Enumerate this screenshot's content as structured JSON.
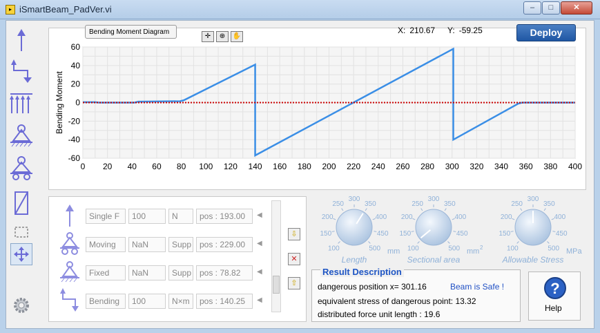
{
  "window": {
    "title": "iSmartBeam_PadVer.vi",
    "minimize": "–",
    "maximize": "□",
    "close": "✕"
  },
  "chart": {
    "palette_label": "Bending Moment Diagram",
    "x_label": "X:",
    "x_value": "210.67",
    "y_label": "Y:",
    "y_value": "-59.25",
    "deploy_label": "Deploy"
  },
  "chart_data": {
    "type": "line",
    "title": "",
    "xlabel": "",
    "ylabel": "Bending Moment",
    "xlim": [
      0,
      400
    ],
    "ylim": [
      -60,
      60
    ],
    "x_ticks": [
      0,
      20,
      40,
      60,
      80,
      100,
      120,
      140,
      160,
      180,
      200,
      220,
      240,
      260,
      280,
      300,
      320,
      340,
      360,
      380,
      400
    ],
    "y_ticks": [
      60,
      40,
      20,
      0,
      -20,
      -40,
      -60
    ],
    "grid": true,
    "series": [
      {
        "color": "#3a8ee6",
        "x": [
          0,
          10,
          13,
          42,
          45,
          79,
          82,
          140,
          140,
          301,
          301,
          354,
          357,
          400
        ],
        "y": [
          0.5,
          0.5,
          0,
          0,
          1,
          1.5,
          2.5,
          41,
          -57,
          58,
          -40,
          -1,
          0,
          0
        ]
      },
      {
        "color": "#cc0000",
        "dashed": true,
        "x": [
          0,
          400
        ],
        "y": [
          0,
          0
        ]
      }
    ]
  },
  "loads": [
    {
      "icon": "single-force-icon",
      "name": "Single F",
      "value": "100",
      "unit": "N",
      "pos": "pos : 193.00"
    },
    {
      "icon": "moving-support-icon",
      "name": "Moving",
      "value": "NaN",
      "unit": "Supp",
      "pos": "pos : 229.00"
    },
    {
      "icon": "fixed-support-icon",
      "name": "Fixed",
      "value": "NaN",
      "unit": "Supp",
      "pos": "pos : 78.82"
    },
    {
      "icon": "bending-moment-icon",
      "name": "Bending",
      "value": "100",
      "unit": "N×m",
      "pos": "pos : 140.25"
    }
  ],
  "knobs": [
    {
      "label": "Length",
      "unit": "mm",
      "ticks": [
        "100",
        "150",
        "200",
        "250",
        "300",
        "350",
        "400",
        "450",
        "500"
      ],
      "value_fraction": 0.62
    },
    {
      "label": "Sectional area",
      "unit": "mm",
      "unit_sup": "2",
      "ticks": [
        "100",
        "150",
        "200",
        "250",
        "300",
        "350",
        "400",
        "450",
        "500"
      ],
      "value_fraction": 0.02
    },
    {
      "label": "Allowable Stress",
      "unit": "MPa",
      "ticks": [
        "100",
        "150",
        "200",
        "250",
        "300",
        "350",
        "400",
        "450",
        "500"
      ],
      "value_fraction": 0.5
    }
  ],
  "result": {
    "title": "Result Description",
    "line1": "dangerous position x= 301.16",
    "safe": "Beam is Safe !",
    "line2": "equivalent stress of dangerous point: 13.32",
    "line3": "distributed force unit length :   19.6"
  },
  "help": {
    "label": "Help"
  }
}
